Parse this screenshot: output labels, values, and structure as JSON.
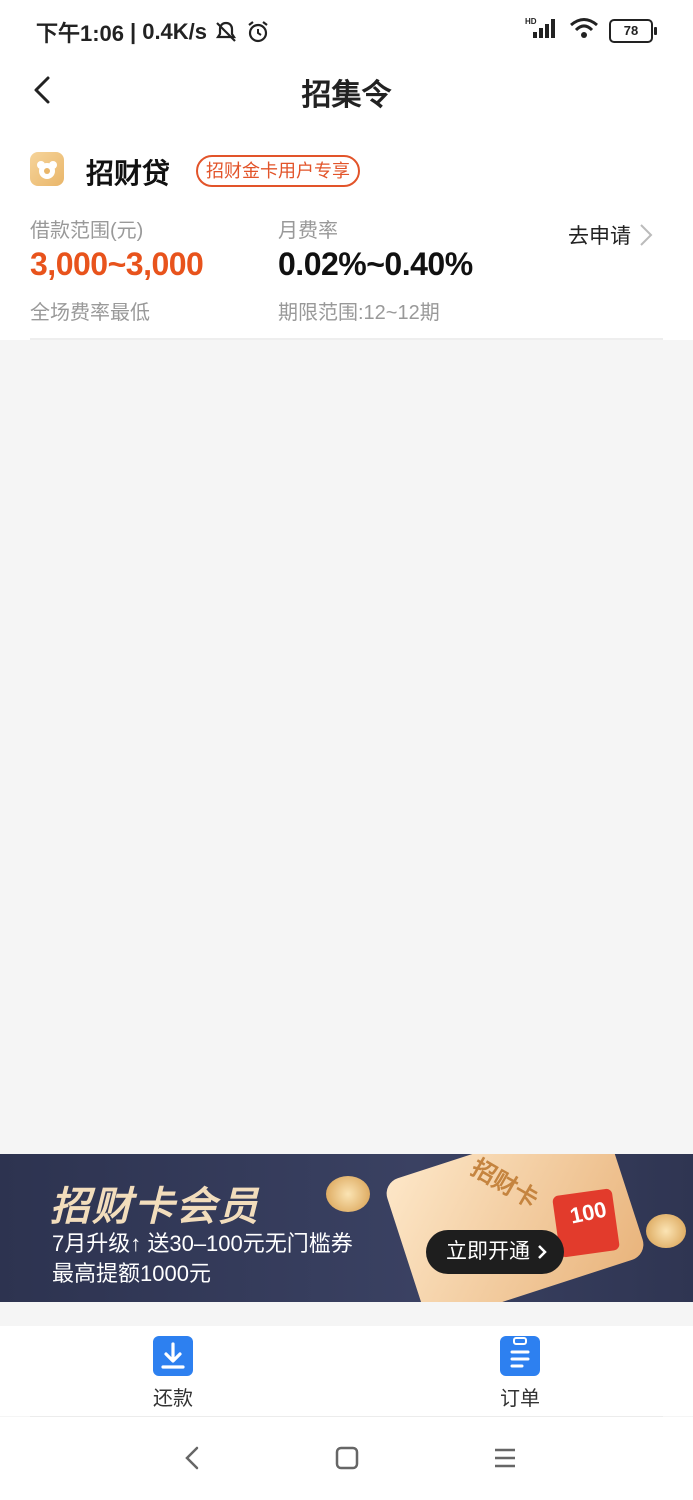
{
  "status_bar": {
    "time": "下午1:06",
    "separator": "|",
    "speed": "0.4K/s",
    "battery": "78"
  },
  "header": {
    "title": "招集令"
  },
  "product": {
    "name": "招财贷",
    "tag": "招财金卡用户专享",
    "range_label": "借款范围(元)",
    "range_value": "3,000~3,000",
    "range_note": "全场费率最低",
    "rate_label": "月费率",
    "rate_value": "0.02%~0.40%",
    "term_note": "期限范围:12~12期",
    "apply_label": "去申请"
  },
  "banner": {
    "title": "招财卡会员",
    "line1": "7月升级↑ 送30–100元无门槛券",
    "line2": "最高提额1000元",
    "cta": "立即开通",
    "card_text": "招财卡",
    "coupon_value": "100"
  },
  "bottom_nav": {
    "items": [
      {
        "label": "还款",
        "icon": "download-icon"
      },
      {
        "label": "订单",
        "icon": "clipboard-icon"
      }
    ]
  },
  "colors": {
    "accent_orange": "#e8531c",
    "nav_blue": "#2d80f0",
    "banner_bg": "#2d3350"
  }
}
